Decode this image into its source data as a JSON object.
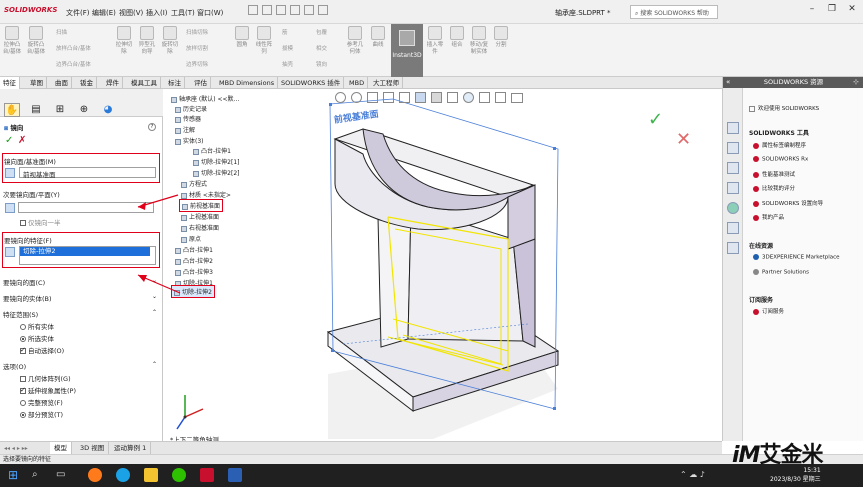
{
  "app": {
    "logo": "SOLIDWORKS",
    "menu": [
      "文件(F)",
      "编辑(E)",
      "视图(V)",
      "插入(I)",
      "工具(T)",
      "窗口(W)"
    ],
    "doc_title": "轴承座.SLDPRT *",
    "help_search_placeholder": "搜索 SOLIDWORKS 帮助"
  },
  "commands": [
    {
      "label": "拉伸凸台/基体"
    },
    {
      "label": "旋转凸台/基体"
    },
    {
      "label": "扫描"
    },
    {
      "label": "放样凸台/基体"
    },
    {
      "label": "边界凸台/基体"
    },
    {
      "label": "拉伸切除"
    },
    {
      "label": "异型孔向导"
    },
    {
      "label": "旋转切除"
    },
    {
      "label": "扫描切除"
    },
    {
      "label": "放样切割"
    },
    {
      "label": "边界切除"
    },
    {
      "label": "圆角"
    },
    {
      "label": "线性阵列"
    },
    {
      "label": "筋"
    },
    {
      "label": "拔模"
    },
    {
      "label": "抽壳"
    },
    {
      "label": "包覆"
    },
    {
      "label": "相交"
    },
    {
      "label": "镜向"
    },
    {
      "label": "参考几何体"
    },
    {
      "label": "曲线"
    },
    {
      "label": "Instant3D"
    },
    {
      "label": "插入零件"
    },
    {
      "label": "组合"
    },
    {
      "label": "移动/复制实体"
    },
    {
      "label": "分割"
    }
  ],
  "tabs": [
    "特征",
    "草图",
    "曲面",
    "钣金",
    "焊件",
    "模具工具",
    "标注",
    "评估",
    "MBD Dimensions",
    "SOLIDWORKS 插件",
    "MBD",
    "大工程师"
  ],
  "pm": {
    "title": "镜向",
    "ok": "✓",
    "cancel": "✗",
    "mirror_plane_header": "镜向面/基准面(M)",
    "mirror_plane_value": "前视基准面",
    "secondary_plane_header": "次要镜向面/平面(Y)",
    "mirror_half": "仅镜向一半",
    "features_header": "要镜向的特征(F)",
    "features_value": "切除-拉伸2",
    "faces_header": "要镜向的面(C)",
    "bodies_header": "要镜向的实体(B)",
    "scope_header": "特征范围(S)",
    "scope_all": "所有实体",
    "scope_selected": "所选实体",
    "auto_select": "自动选择(O)",
    "options_header": "选项(O)",
    "geometry_pattern": "几何体阵列(G)",
    "propagate_visual": "延伸视象属性(P)",
    "full_preview": "完整预览(F)",
    "partial_preview": "部分预览(T)"
  },
  "tree": {
    "root": "轴承座 (默认) <<默...",
    "items": [
      "历史记录",
      "传感器",
      "注解",
      "实体(3)",
      "凸台-拉伸1",
      "切除-拉伸2[1]",
      "切除-拉伸2[2]",
      "方程式",
      "材质 <未指定>",
      "前视基准面",
      "上视基准面",
      "右视基准面",
      "原点",
      "凸台-拉伸1",
      "凸台-拉伸2",
      "凸台-拉伸3",
      "切除-拉伸1",
      "切除-拉伸2"
    ]
  },
  "viewport": {
    "plane_label": "前视基准面",
    "view_label": "*上下二等角轴测"
  },
  "taskpane": {
    "title": "SOLIDWORKS 资源",
    "welcome": "欢迎使用 SOLIDWORKS",
    "tools_header": "SOLIDWORKS 工具",
    "tools": [
      "属性标签编制程序",
      "SOLIDWORKS Rx",
      "性能基准测试",
      "比较我的评分",
      "SOLIDWORKS 设置向导",
      "我的产品"
    ],
    "online_header": "在线资源",
    "online": [
      "3DEXPERIENCE Marketplace",
      "Partner Solutions"
    ],
    "subscription_header": "订阅服务",
    "subscription": [
      "订阅服务"
    ]
  },
  "bottom_tabs": [
    "模型",
    "3D 视图",
    "运动算例 1"
  ],
  "status": "选择要镜向的特征",
  "clock": {
    "time": "15:31",
    "date": "2023/8/30 星期三"
  },
  "watermark": {
    "im": "iM",
    "text": "艾金米"
  },
  "colors": {
    "red_highlight": "#e0001a",
    "selection_blue": "#1e6fd9",
    "preview_yellow": "#f2e600"
  }
}
